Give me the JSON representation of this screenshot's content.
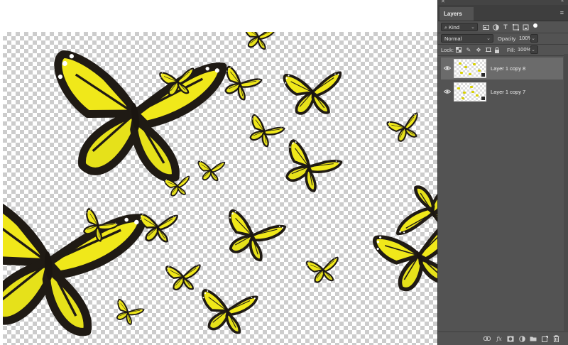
{
  "layers_panel": {
    "tab_label": "Layers",
    "filter": {
      "label": "Kind"
    },
    "blend_mode": "Normal",
    "opacity": {
      "label": "Opacity:",
      "value": "100%"
    },
    "lock": {
      "label": "Lock:"
    },
    "fill": {
      "label": "Fill:",
      "value": "100%"
    },
    "layers": [
      {
        "name": "Layer 1 copy 8",
        "visible": true,
        "selected": true
      },
      {
        "name": "Layer 1 copy 7",
        "visible": true,
        "selected": false
      }
    ],
    "footer_icons": [
      "link-icon",
      "fx-icon",
      "mask-icon",
      "adjustment-icon",
      "folder-icon",
      "new-layer-icon",
      "trash-icon"
    ]
  },
  "canvas": {
    "background": "transparent-checkerboard",
    "subject": "yellow monarch butterflies"
  },
  "colors": {
    "panel_bg": "#535353",
    "selected_row": "#6b6b6b",
    "wing_yellow": "#f0e81a",
    "wing_edge": "#1f1a14"
  }
}
